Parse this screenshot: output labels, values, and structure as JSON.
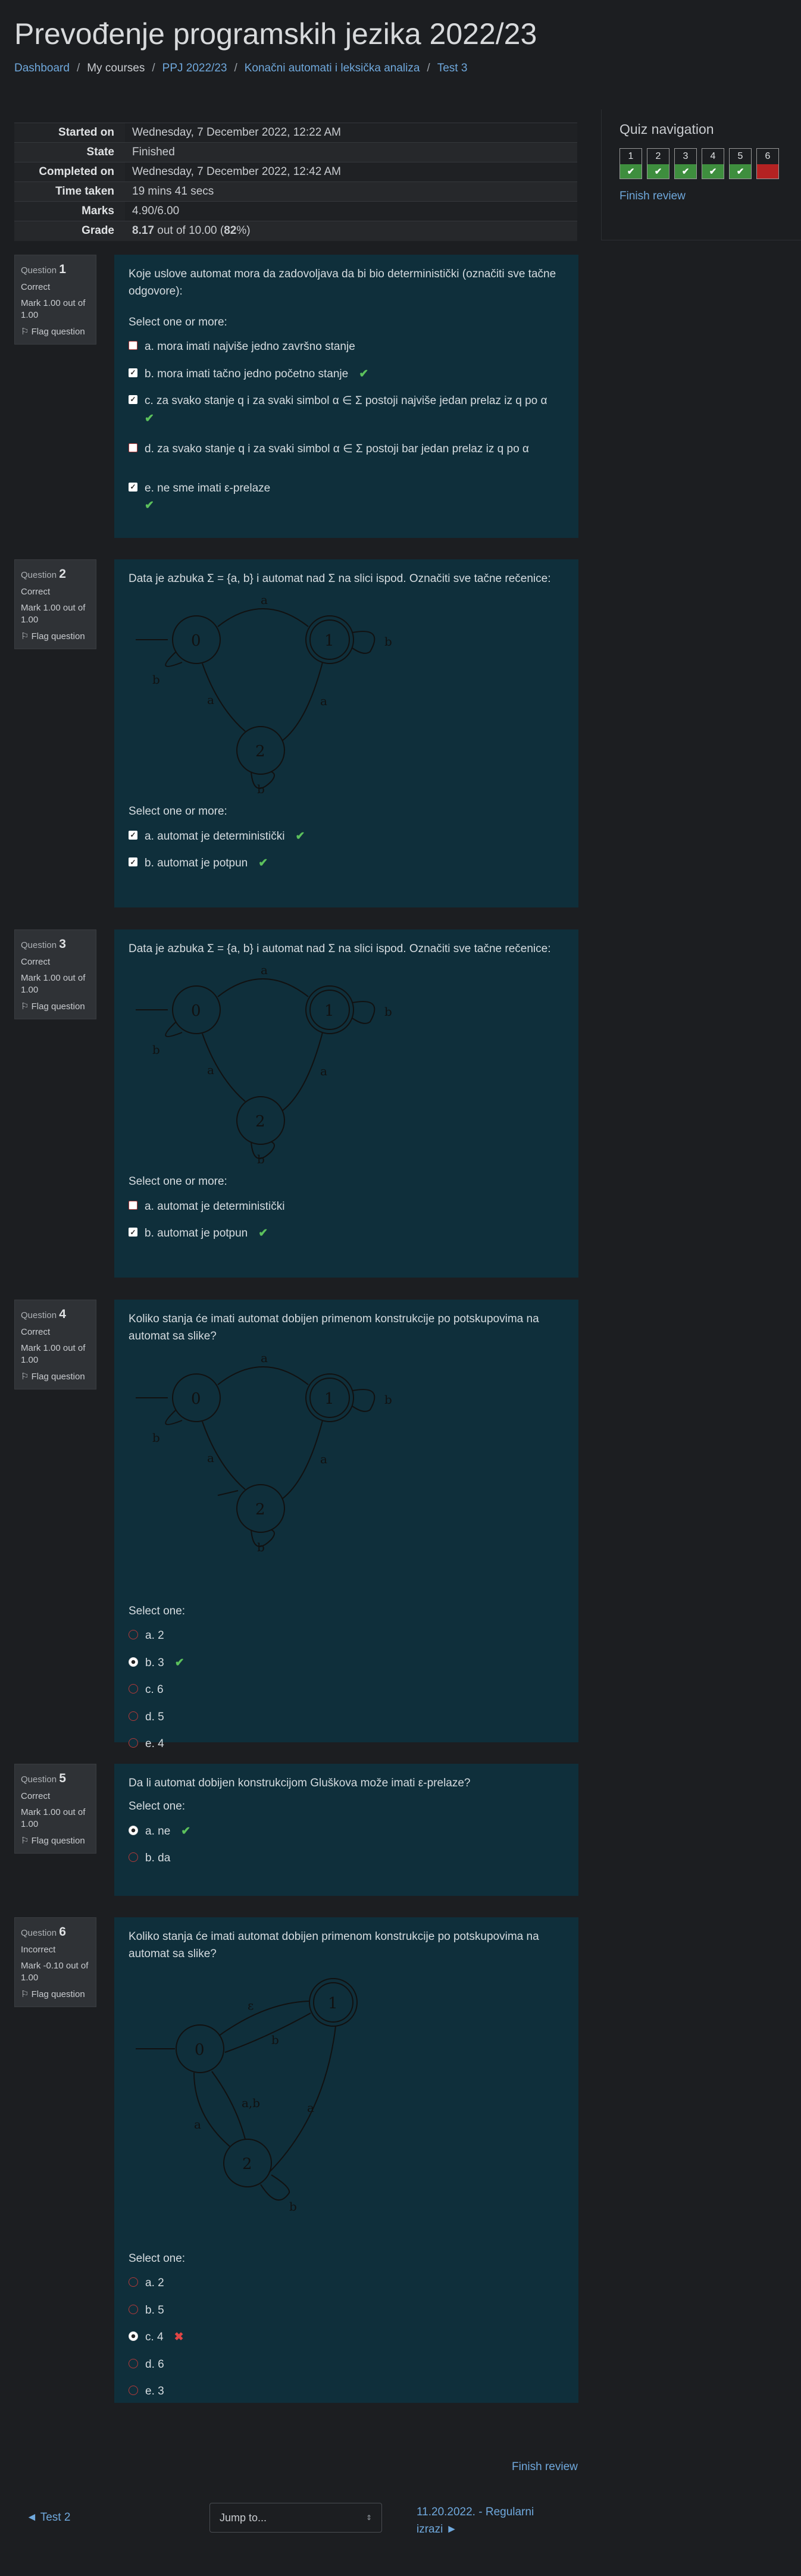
{
  "page": {
    "title": "Prevođenje programskih jezika 2022/23"
  },
  "breadcrumb": [
    "Dashboard",
    "My courses",
    "PPJ 2022/23",
    "Konačni automati i leksička analiza",
    "Test 3"
  ],
  "summary": {
    "rows": [
      {
        "label": "Started on",
        "value": "Wednesday, 7 December 2022, 12:22 AM"
      },
      {
        "label": "State",
        "value": "Finished"
      },
      {
        "label": "Completed on",
        "value": "Wednesday, 7 December 2022, 12:42 AM"
      },
      {
        "label": "Time taken",
        "value": "19 mins 41 secs"
      },
      {
        "label": "Marks",
        "value": "4.90/6.00"
      }
    ],
    "grade_label": "Grade",
    "grade_value": "8.17",
    "grade_rest_1": " out of 10.00 (",
    "grade_percent": "82",
    "grade_rest_2": "%)"
  },
  "quiz_nav": {
    "title": "Quiz navigation",
    "buttons": [
      {
        "num": "1",
        "status": "correct"
      },
      {
        "num": "2",
        "status": "correct"
      },
      {
        "num": "3",
        "status": "correct"
      },
      {
        "num": "4",
        "status": "correct"
      },
      {
        "num": "5",
        "status": "correct"
      },
      {
        "num": "6",
        "status": "incorrect"
      }
    ],
    "finish_review": "Finish review"
  },
  "colors": {
    "correct": "#3e8e3e",
    "incorrect": "#b42222",
    "question_bg": "#0f2f3b",
    "link": "#6fa8dc"
  },
  "question_word": "Question",
  "flag_label": "Flag question",
  "q1": {
    "num": "1",
    "state": "Correct",
    "mark": "Mark 1.00 out of 1.00",
    "text": "Koje uslove automat mora da zadovoljava da bi bio deterministički (označiti sve tačne odgovore):",
    "prompt": "Select one or more:",
    "options": [
      "a. mora imati najviše jedno završno stanje",
      "b. mora imati tačno jedno početno stanje",
      "c. za svako stanje q i za svaki simbol α ∈ Σ postoji najviše jedan prelaz iz q po α",
      "d. za svako stanje q i za svaki simbol α ∈ Σ postoji bar jedan prelaz iz q po α",
      "e. ne sme imati ε-prelaze"
    ]
  },
  "q2": {
    "num": "2",
    "state": "Correct",
    "mark": "Mark 1.00 out of 1.00",
    "text": "Data je azbuka Σ = {a, b} i automat nad Σ na slici ispod. Označiti sve tačne rečenice:",
    "prompt": "Select one or more:",
    "options": [
      "a. automat je deterministički",
      "b. automat je potpun"
    ]
  },
  "q3": {
    "num": "3",
    "state": "Correct",
    "mark": "Mark 1.00 out of 1.00",
    "text": "Data je azbuka Σ = {a, b} i automat nad Σ na slici ispod. Označiti sve tačne rečenice:",
    "prompt": "Select one or more:",
    "options": [
      "a. automat je deterministički",
      "b. automat je potpun"
    ]
  },
  "q4": {
    "num": "4",
    "state": "Correct",
    "mark": "Mark 1.00 out of 1.00",
    "text": "Koliko stanja će imati automat dobijen primenom konstrukcije po potskupovima na automat sa slike?",
    "prompt": "Select one:",
    "options": [
      "a. 2",
      "b. 3",
      "c. 6",
      "d. 5",
      "e. 4"
    ]
  },
  "q5": {
    "num": "5",
    "state": "Correct",
    "mark": "Mark 1.00 out of 1.00",
    "text": "Da li automat dobijen konstrukcijom Gluškova može imati ε-prelaze?",
    "prompt": "Select one:",
    "options": [
      "a. ne",
      "b. da"
    ]
  },
  "q6": {
    "num": "6",
    "state": "Incorrect",
    "mark": "Mark -0.10 out of 1.00",
    "text": "Koliko stanja će imati automat dobijen primenom konstrukcije po potskupovima na automat sa slike?",
    "prompt": "Select one:",
    "options": [
      "a. 2",
      "b. 5",
      "c. 4",
      "d. 6",
      "e. 3"
    ]
  },
  "automaton": {
    "states": [
      "0",
      "1",
      "2"
    ],
    "sym_a": "a",
    "sym_b": "b",
    "sym_eps": "ε",
    "sym_ab": "a,b"
  },
  "footer": {
    "finish_review": "Finish review",
    "prev": "◄ Test 2",
    "jump": "Jump to...",
    "next": "11.20.2022. - Regularni izrazi ►"
  }
}
